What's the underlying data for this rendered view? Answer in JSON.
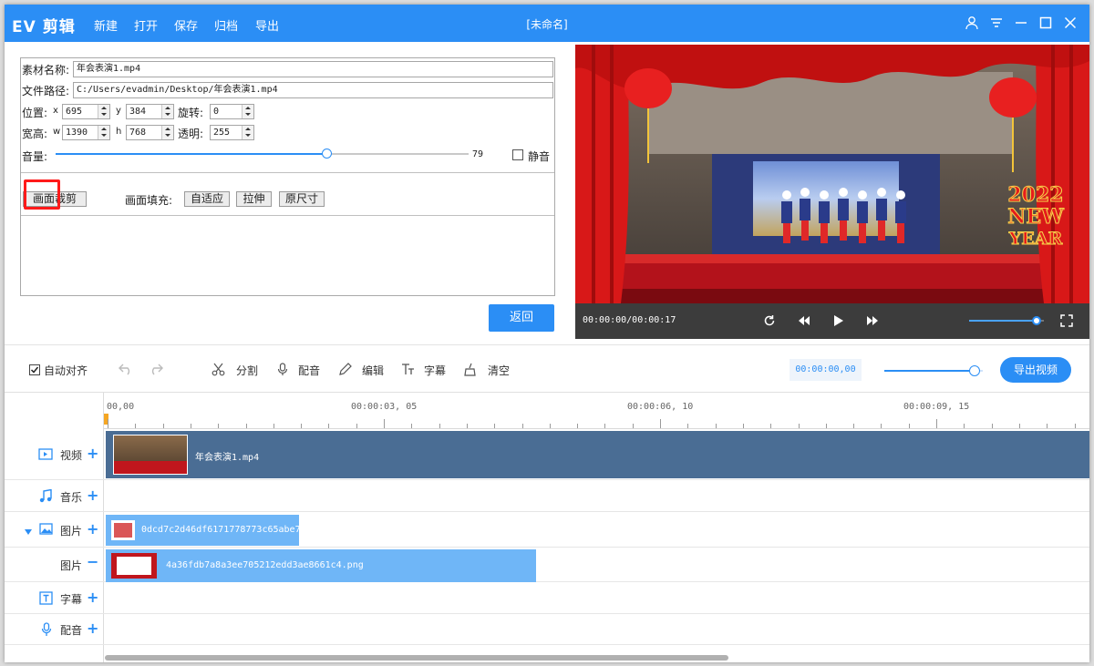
{
  "app": {
    "logo": "EV 剪辑",
    "doc_title": "[未命名]"
  },
  "menu": [
    "新建",
    "打开",
    "保存",
    "归档",
    "导出"
  ],
  "window_icons": [
    "user-icon",
    "settings-icon",
    "minimize-icon",
    "maximize-icon",
    "close-icon"
  ],
  "props": {
    "name_label": "素材名称:",
    "name_value": "年会表演1.mp4",
    "path_label": "文件路径:",
    "path_value": "C:/Users/evadmin/Desktop/年会表演1.mp4",
    "pos_label": "位置:",
    "x_label": "x",
    "x_value": "695",
    "y_label": "y",
    "y_value": "384",
    "rot_label": "旋转:",
    "rot_value": "0",
    "size_label": "宽高:",
    "w_label": "w",
    "w_value": "1390",
    "h_label": "h",
    "h_value": "768",
    "alpha_label": "透明:",
    "alpha_value": "255",
    "volume_label": "音量:",
    "volume_value": "79",
    "volume_level": 0.79,
    "mute_label": "静音",
    "mute_checked": false,
    "crop_button": "画面裁剪",
    "fill_label": "画面填充:",
    "fill_adaptive": "自适应",
    "fill_stretch": "拉伸",
    "fill_original": "原尺寸",
    "back_button": "返回"
  },
  "preview": {
    "time": "00:00:00/00:00:17",
    "banner_top": "2022",
    "banner_mid": "NEW",
    "banner_bot": "YEAR",
    "volume_level": 0.9
  },
  "toolbar": {
    "auto_align": "自动对齐",
    "auto_align_checked": true,
    "split": "分割",
    "dub": "配音",
    "edit": "编辑",
    "subtitle": "字幕",
    "clear": "清空",
    "timecode": "00:00:00,00",
    "zoom_level": 0.92,
    "export": "导出视频"
  },
  "ruler": {
    "labels": [
      "00,00",
      "00:00:03, 05",
      "00:00:06, 10",
      "00:00:09, 15"
    ]
  },
  "tracks": {
    "video": "视频",
    "music": "音乐",
    "image1": "图片",
    "image2": "图片",
    "subtitle": "字幕",
    "dub": "配音"
  },
  "clips": {
    "video_clip": "年会表演1.mp4",
    "image_clip1": "0dcd7c2d46df6171778773c65abe7",
    "image_clip2": "4a36fdb7a8a3ee705212edd3ae8661c4.png"
  },
  "colors": {
    "accent": "#2b8ef5",
    "video_clip": "#4a6d94",
    "image_clip": "#6fb6f7",
    "highlight": "#ff1a1a"
  }
}
